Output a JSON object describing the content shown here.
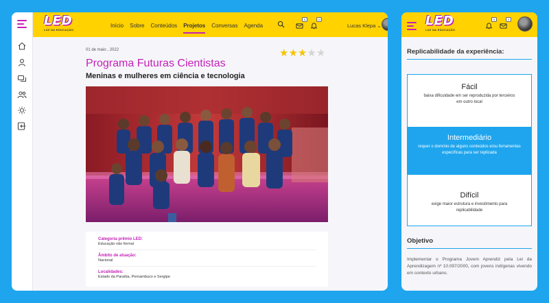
{
  "app": {
    "logo_text": "LED",
    "logo_sub": "LUZ NA EDUCAÇÃO"
  },
  "nav": {
    "items": [
      "Início",
      "Sobre",
      "Conteúdos",
      "Projetos",
      "Conversas",
      "Agenda"
    ],
    "active": "Projetos"
  },
  "header": {
    "messages_badge": "5",
    "notifications_badge": "12",
    "user_name": "Lucas Klepa"
  },
  "article": {
    "date": "01 de maio , 2022",
    "rating": 3,
    "rating_max": 5,
    "title": "Programa Futuras Cientistas",
    "subtitle": "Meninas e mulheres em ciência e tecnologia",
    "info": [
      {
        "label": "Categoria prêmio LED:",
        "value": "Educação não formal"
      },
      {
        "label": "Âmbito de atuação:",
        "value": "Nacional"
      },
      {
        "label": "Localidades:",
        "value": "Estado da Paraíba, Pernambuco e Sergipe"
      }
    ]
  },
  "mobile": {
    "messages_badge": "0",
    "notifications_badge": "0",
    "replicability_heading": "Replicabilidade da experiência:",
    "options": [
      {
        "title": "Fácil",
        "desc": "baixa dificuldade em ser reproduzida por terceiros em outro local",
        "selected": false
      },
      {
        "title": "Intermediário",
        "desc": "requer o domínio de alguns conteúdos e/ou ferramentas específicas para ser replicada",
        "selected": true
      },
      {
        "title": "Difícil",
        "desc": "exige maior estrutura e investimento para replicabilidade",
        "selected": false
      }
    ],
    "objective_heading": "Objetivo",
    "objective_text": "Implementar o Programa Jovem Aprendiz pela Lei da Aprendizagem nº 10.097/2000, com jovens indígenas vivendo em contexto urbano."
  },
  "colors": {
    "accent": "#c320b8",
    "topbar": "#ffd200",
    "background": "#1ea5ee",
    "star": "#f4c400"
  }
}
